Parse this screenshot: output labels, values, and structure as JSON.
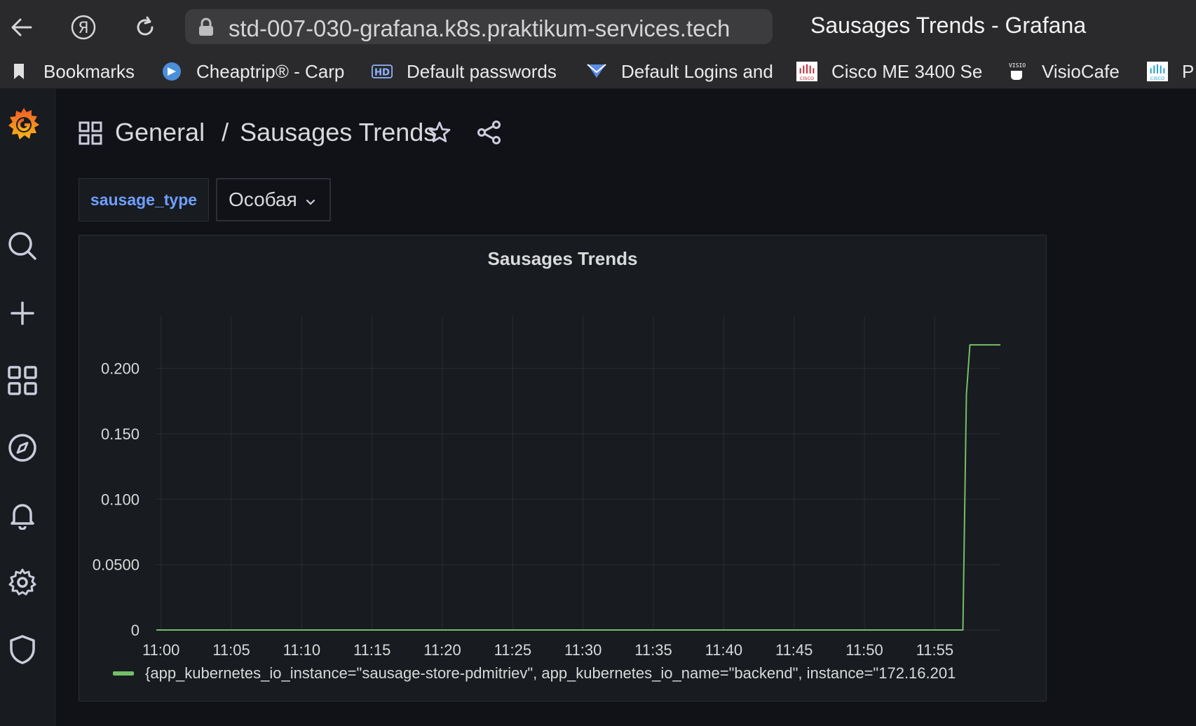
{
  "browser": {
    "url": "std-007-030-grafana.k8s.praktikum-services.tech",
    "tab_title": "Sausages Trends - Grafana",
    "bookmarks": [
      {
        "label": "Bookmarks",
        "icon": "bookmark-icon"
      },
      {
        "label": "Cheaptrip® - Carp",
        "icon": "cheaptrip-icon"
      },
      {
        "label": "Default passwords",
        "icon": "hd-icon"
      },
      {
        "label": "Default Logins and",
        "icon": "mail-icon"
      },
      {
        "label": "Cisco ME 3400 Se",
        "icon": "cisco-icon"
      },
      {
        "label": "VisioCafe",
        "icon": "visiocafe-icon"
      },
      {
        "label": "P",
        "icon": "cisco-icon"
      }
    ]
  },
  "dashboard": {
    "folder": "General",
    "separator": "/",
    "title": "Sausages Trends"
  },
  "variables": {
    "label": "sausage_type",
    "value": "Особая"
  },
  "panel": {
    "title": "Sausages Trends",
    "legend": "{app_kubernetes_io_instance=\"sausage-store-pdmitriev\", app_kubernetes_io_name=\"backend\", instance=\"172.16.201"
  },
  "colors": {
    "series": "#73bf69",
    "accent": "#6e9fff",
    "background": "#111217",
    "panel": "#181b1f"
  },
  "chart_data": {
    "type": "line",
    "title": "Sausages Trends",
    "x_ticks": [
      "11:00",
      "11:05",
      "11:10",
      "11:15",
      "11:20",
      "11:25",
      "11:30",
      "11:35",
      "11:40",
      "11:45",
      "11:50",
      "11:55"
    ],
    "y_ticks": [
      "0",
      "0.0500",
      "0.100",
      "0.150",
      "0.200"
    ],
    "xlim": [
      "10:59:40",
      "11:59:40"
    ],
    "ylim": [
      0,
      0.24
    ],
    "grid": true,
    "legend_position": "bottom",
    "series": [
      {
        "x": [
          "10:59:40",
          "11:57:00",
          "11:57:15",
          "11:57:30",
          "11:59:40"
        ],
        "y": [
          0,
          0,
          0.18,
          0.218,
          0.218
        ]
      }
    ]
  }
}
